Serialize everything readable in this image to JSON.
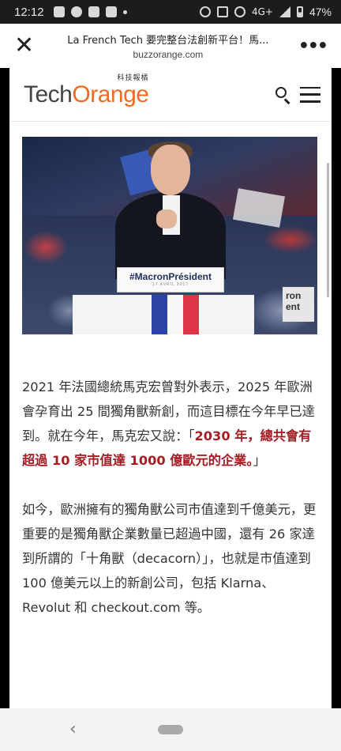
{
  "status_bar": {
    "time": "12:12",
    "network": "4G+",
    "battery": "47%",
    "battery_level": 0.47
  },
  "browser": {
    "close_icon": "close-icon",
    "page_title": "La French Tech 要完整台法創新平台！馬...",
    "url": "buzzorange.com",
    "more_icon": "more-icon"
  },
  "site": {
    "logo_tech": "Tech",
    "logo_orange": "Orange",
    "logo_sub": "科技報橘",
    "search_icon": "search-icon",
    "menu_icon": "menu-icon"
  },
  "hero": {
    "sign_text": "#MacronPrésident",
    "sign_date": "17 AVRIL 2017",
    "right_sign_text": "ron ent"
  },
  "article": {
    "p1_text": "2021 年法國總統馬克宏曾對外表示，2025 年歐洲會孕育出 25 間獨角獸新創，而這目標在今年早已達到。就在今年，馬克宏又說：「",
    "p1_highlight": "2030 年，總共會有超過 10 家市值達 1000 億歐元的企業。",
    "p1_end": "」",
    "p2_text": "如今，歐洲擁有的獨角獸公司市值達到千億美元，更重要的是獨角獸企業數量已超過中國，還有 26 家達到所謂的「十角獸（decacorn）」，也就是市值達到 100 億美元以上的新創公司，包括 Klarna、Revolut 和 checkout.com 等。"
  },
  "colors": {
    "brand_orange": "#f26a21",
    "highlight_red": "#a61d24"
  }
}
